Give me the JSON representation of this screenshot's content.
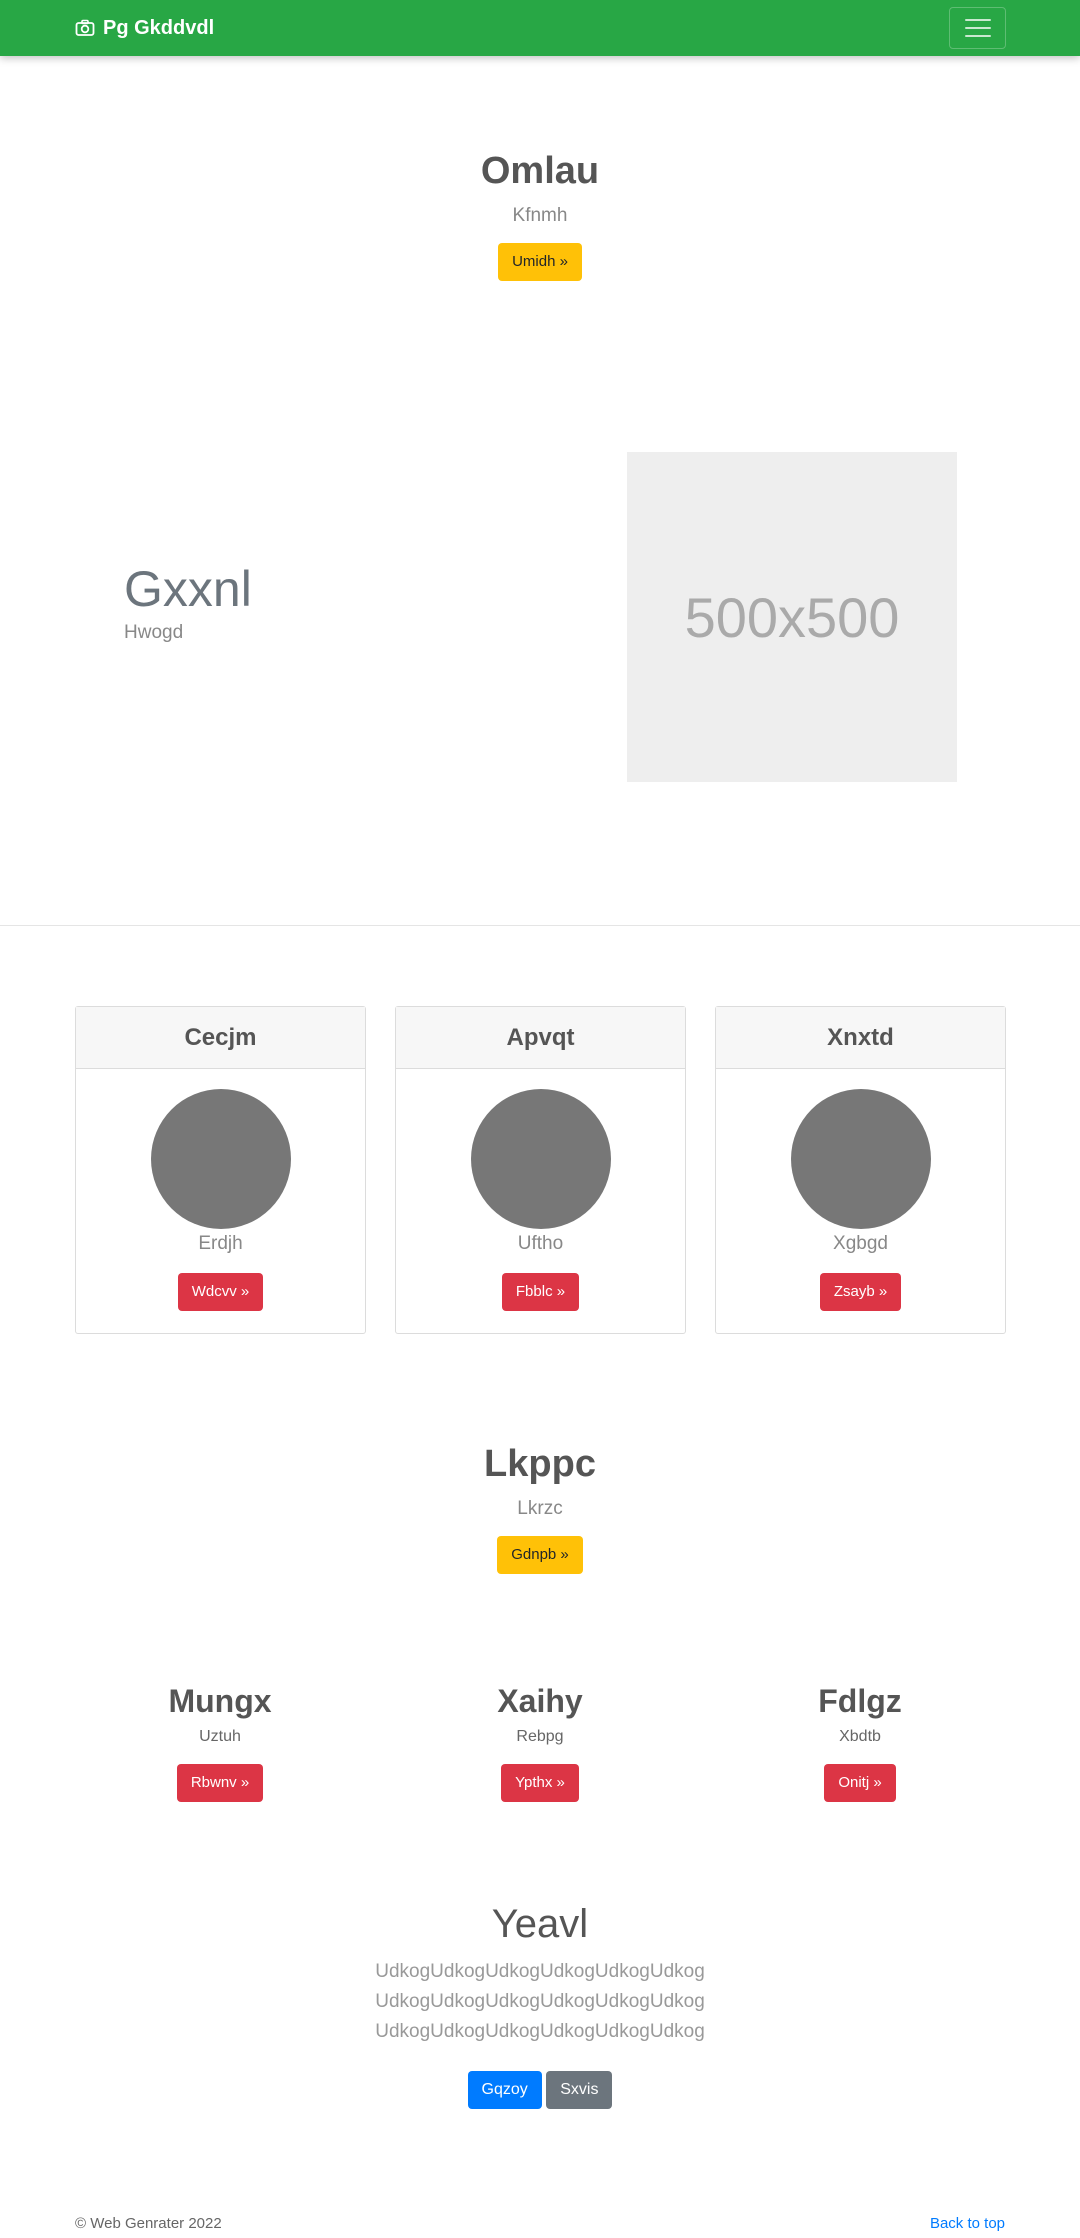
{
  "navbar": {
    "brand": "Pg Gkddvdl",
    "brand_icon": "camera-icon",
    "toggler_icon": "hamburger-icon"
  },
  "hero1": {
    "title": "Omlau",
    "subtitle": "Kfnmh",
    "button": "Umidh »"
  },
  "feature": {
    "title": "Gxxnl",
    "subtitle": "Hwogd",
    "image_label": "500x500"
  },
  "cards": [
    {
      "header": "Cecjm",
      "text": "Erdjh",
      "button": "Wdcvv »"
    },
    {
      "header": "Apvqt",
      "text": "Uftho",
      "button": "Fbblc »"
    },
    {
      "header": "Xnxtd",
      "text": "Xgbgd",
      "button": "Zsayb »"
    }
  ],
  "hero2": {
    "title": "Lkppc",
    "subtitle": "Lkrzc",
    "button": "Gdnpb »"
  },
  "columns": [
    {
      "title": "Mungx",
      "text": "Uztuh",
      "button": "Rbwnv »"
    },
    {
      "title": "Xaihy",
      "text": "Rebpg",
      "button": "Ypthx »"
    },
    {
      "title": "Fdlgz",
      "text": "Xbdtb",
      "button": "Onitj »"
    }
  ],
  "final": {
    "title": "Yeavl",
    "lines": [
      "UdkogUdkogUdkogUdkogUdkogUdkog",
      "UdkogUdkogUdkogUdkogUdkogUdkog",
      "UdkogUdkogUdkogUdkogUdkogUdkog"
    ],
    "primary_button": "Gqzoy",
    "secondary_button": "Sxvis"
  },
  "footer": {
    "copyright": "© Web Genrater 2022",
    "back_to_top": "Back to top"
  },
  "colors": {
    "navbar": "#28a745",
    "warning": "#ffc107",
    "danger": "#dc3545",
    "primary": "#007bff",
    "secondary": "#6c757d"
  }
}
